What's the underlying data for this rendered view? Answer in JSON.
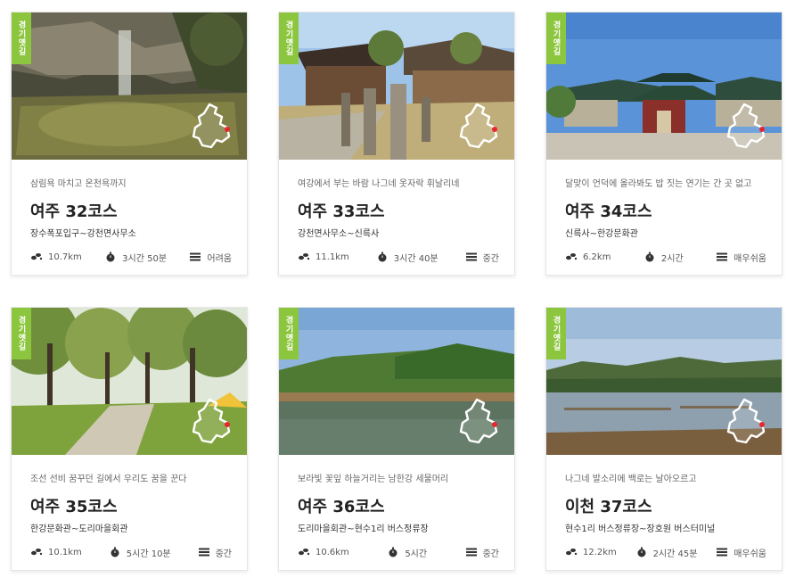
{
  "cards": [
    {
      "badge": "경기옛길",
      "subtitle": "삼림욕 마치고 온천욕까지",
      "title": "여주 32코스",
      "route": "장수폭포입구~강천면사무소",
      "distance": "10.7km",
      "time": "3시간 50분",
      "difficulty": "어려움",
      "scene": "waterfall"
    },
    {
      "badge": "경기옛길",
      "subtitle": "여강에서 부는 바람 나그네 옷자락 휘날리네",
      "title": "여주 33코스",
      "route": "강천면사무소~신륵사",
      "distance": "11.1km",
      "time": "3시간 40분",
      "difficulty": "중간",
      "scene": "statues"
    },
    {
      "badge": "경기옛길",
      "subtitle": "달맞이 언덕에 올라봐도 밥 짓는 연기는 간 곳 없고",
      "title": "여주 34코스",
      "route": "신륵사~한강문화관",
      "distance": "6.2km",
      "time": "2시간",
      "difficulty": "매우쉬움",
      "scene": "temple"
    },
    {
      "badge": "경기옛길",
      "subtitle": "조선 선비 꿈꾸던 길에서 우리도 꿈을 꾼다",
      "title": "여주 35코스",
      "route": "한강문화관~도리마을회관",
      "distance": "10.1km",
      "time": "5시간 10분",
      "difficulty": "중간",
      "scene": "trees"
    },
    {
      "badge": "경기옛길",
      "subtitle": "보라빛 꽃잎 하늘거리는 남한강 세물머리",
      "title": "여주 36코스",
      "route": "도리마을회관~현수1리 버스정류장",
      "distance": "10.6km",
      "time": "5시간",
      "difficulty": "중간",
      "scene": "river"
    },
    {
      "badge": "경기옛길",
      "subtitle": "나그네 발소리에 백로는 날아오르고",
      "title": "이천 37코스",
      "route": "현수1리 버스정류장~장호원 버스터미널",
      "distance": "12.2km",
      "time": "2시간 45분",
      "difficulty": "매우쉬움",
      "scene": "lake"
    }
  ],
  "colors": {
    "badge": "#8cc63f",
    "route_marker": "#e8262b"
  },
  "icons": {
    "distance": "footprints-icon",
    "time": "stopwatch-icon",
    "difficulty": "difficulty-bars-icon",
    "map": "route-map-icon"
  }
}
